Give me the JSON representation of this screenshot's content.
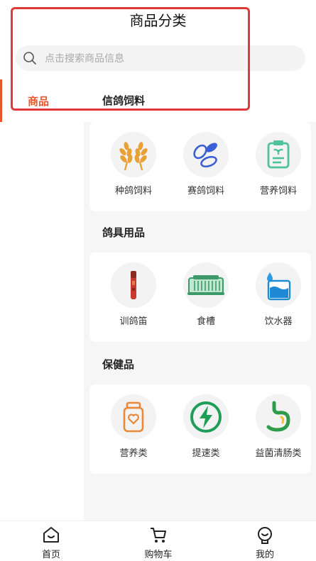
{
  "header": {
    "title": "商品分类",
    "search": {
      "placeholder": "点击搜索商品信息",
      "icon": "search-icon"
    }
  },
  "sidebar": {
    "items": [
      {
        "label": "商品",
        "selected": true
      }
    ],
    "accent_color": "#e8572a"
  },
  "content": {
    "sections": [
      {
        "title": "信鸽饲料",
        "items": [
          {
            "label": "种鸽饲料",
            "icon": "wheat-icon"
          },
          {
            "label": "赛鸽饲料",
            "icon": "seeds-icon"
          },
          {
            "label": "营养饲料",
            "icon": "nutrition-clipboard-icon"
          }
        ]
      },
      {
        "title": "鸽具用品",
        "items": [
          {
            "label": "训鸽笛",
            "icon": "whistle-icon"
          },
          {
            "label": "食槽",
            "icon": "feeding-trough-icon"
          },
          {
            "label": "饮水器",
            "icon": "water-drinker-icon"
          }
        ]
      },
      {
        "title": "保健品",
        "items": [
          {
            "label": "营养类",
            "icon": "supplement-jar-icon"
          },
          {
            "label": "提速类",
            "icon": "speed-boost-icon"
          },
          {
            "label": "益菌清肠类",
            "icon": "stomach-icon"
          }
        ]
      }
    ]
  },
  "tabbar": {
    "tabs": [
      {
        "label": "首页",
        "icon": "home-icon"
      },
      {
        "label": "购物车",
        "icon": "cart-icon"
      },
      {
        "label": "我的",
        "icon": "profile-icon"
      }
    ]
  },
  "highlight_color": "#e0393a"
}
